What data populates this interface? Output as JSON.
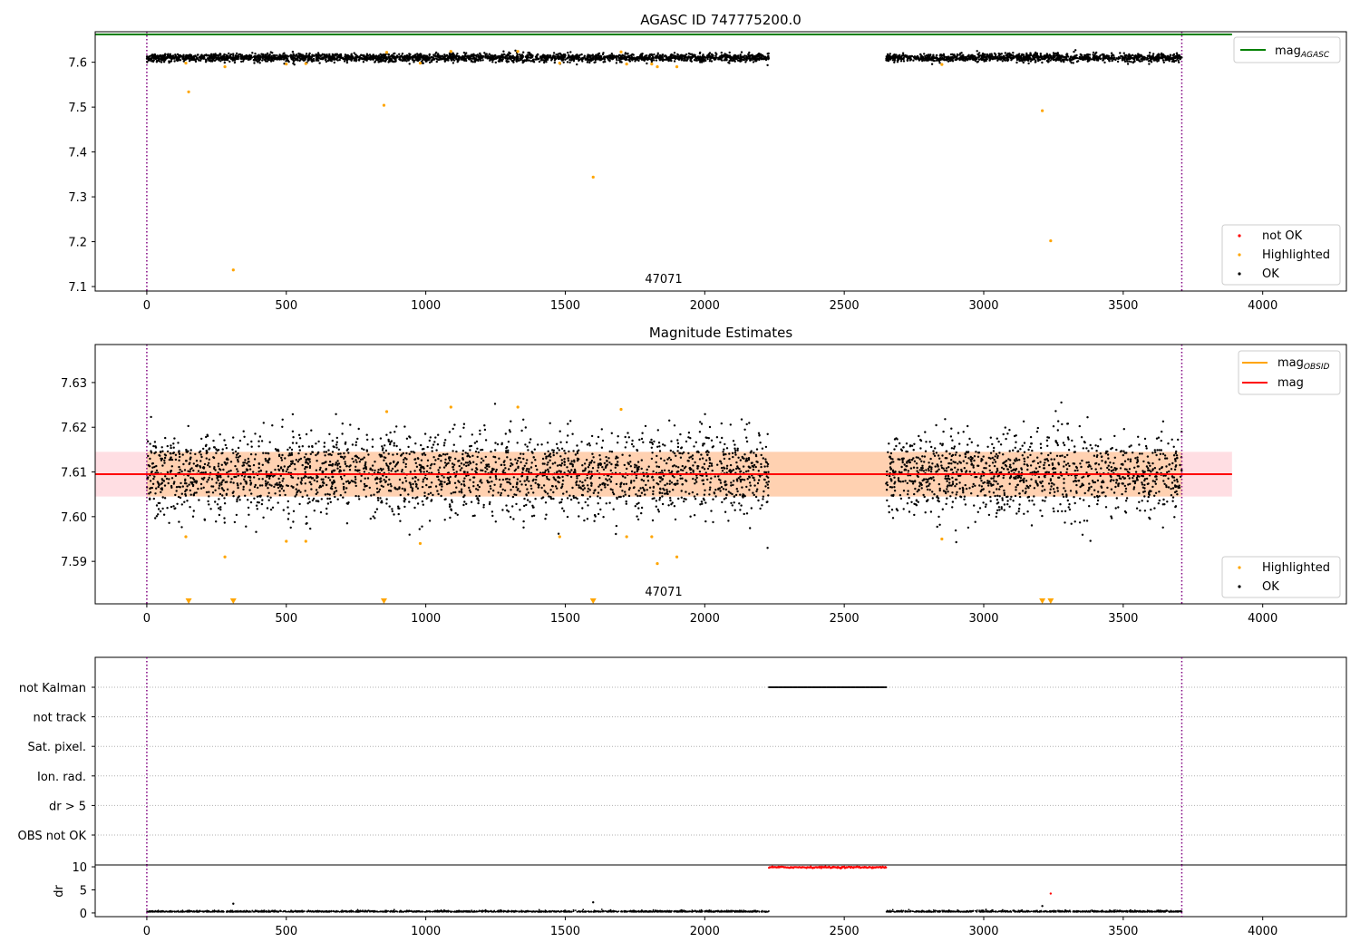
{
  "chart_data": [
    {
      "type": "scatter",
      "title": "AGASC ID 747775200.0",
      "xlim": [
        -185,
        4300
      ],
      "ylim": [
        7.09,
        7.668
      ],
      "xticks": [
        0,
        500,
        1000,
        1500,
        2000,
        2500,
        3000,
        3500,
        4000
      ],
      "yticks": [
        7.1,
        7.2,
        7.3,
        7.4,
        7.5,
        7.6
      ],
      "ytick_labels": [
        "7.1",
        "7.2",
        "7.3",
        "7.4",
        "7.5",
        "7.6"
      ],
      "obsid_label": "47071",
      "obsid_label_x": 1850,
      "vlines": [
        0,
        3710
      ],
      "vline_color": "#800080",
      "mag_agasc": 7.662,
      "mag_agasc_color": "#008000",
      "ok_segments": [
        {
          "x_start": 0,
          "x_end": 2230,
          "mean": 7.61,
          "spread": 0.006
        },
        {
          "x_start": 2650,
          "x_end": 3710,
          "mean": 7.61,
          "spread": 0.006
        }
      ],
      "highlighted_points": [
        [
          150,
          7.534
        ],
        [
          140,
          7.598
        ],
        [
          280,
          7.59
        ],
        [
          310,
          7.137
        ],
        [
          500,
          7.596
        ],
        [
          570,
          7.597
        ],
        [
          850,
          7.504
        ],
        [
          860,
          7.622
        ],
        [
          980,
          7.598
        ],
        [
          1090,
          7.624
        ],
        [
          1330,
          7.624
        ],
        [
          1480,
          7.598
        ],
        [
          1600,
          7.344
        ],
        [
          1700,
          7.623
        ],
        [
          1720,
          7.596
        ],
        [
          1810,
          7.596
        ],
        [
          1830,
          7.59
        ],
        [
          1900,
          7.59
        ],
        [
          2850,
          7.595
        ],
        [
          3210,
          7.492
        ],
        [
          3240,
          7.202
        ]
      ],
      "legend_top": [
        {
          "name": "mag",
          "subscript": "AGASC",
          "color": "#008000"
        }
      ],
      "legend_bottom": [
        {
          "name": "not OK",
          "color": "#ff0000"
        },
        {
          "name": "Highlighted",
          "color": "#ffa500"
        },
        {
          "name": "OK",
          "color": "#000000"
        }
      ],
      "legend_placement": [
        "upper right",
        "lower right"
      ]
    },
    {
      "type": "scatter",
      "title": "Magnitude Estimates",
      "xlim": [
        -185,
        4300
      ],
      "ylim": [
        7.5805,
        7.6385
      ],
      "xticks": [
        0,
        500,
        1000,
        1500,
        2000,
        2500,
        3000,
        3500,
        4000
      ],
      "yticks": [
        7.59,
        7.6,
        7.61,
        7.62,
        7.63
      ],
      "ytick_labels": [
        "7.59",
        "7.60",
        "7.61",
        "7.62",
        "7.63"
      ],
      "obsid_label": "47071",
      "obsid_label_x": 1850,
      "vlines": [
        0,
        3710
      ],
      "mag": 7.6095,
      "mag_color": "#ff0000",
      "mag_band": [
        7.6045,
        7.6145
      ],
      "mag_band_x": [
        -185,
        3890
      ],
      "mag_obsid": 7.6095,
      "mag_obsid_color": "#ffa500",
      "mag_obsid_band_x": [
        0,
        3710
      ],
      "ok_segments": [
        {
          "x_start": 0,
          "x_end": 2230,
          "mean": 7.6095,
          "spread": 0.0045
        },
        {
          "x_start": 2650,
          "x_end": 3710,
          "mean": 7.6095,
          "spread": 0.0045
        }
      ],
      "highlighted_points": [
        [
          140,
          7.5955
        ],
        [
          280,
          7.591
        ],
        [
          500,
          7.5945
        ],
        [
          570,
          7.5945
        ],
        [
          860,
          7.6235
        ],
        [
          980,
          7.594
        ],
        [
          1090,
          7.6245
        ],
        [
          1330,
          7.6245
        ],
        [
          1480,
          7.5955
        ],
        [
          1700,
          7.624
        ],
        [
          1720,
          7.5955
        ],
        [
          1810,
          7.5955
        ],
        [
          1830,
          7.5895
        ],
        [
          1900,
          7.591
        ],
        [
          2850,
          7.595
        ]
      ],
      "out_of_range_markers": [
        150,
        310,
        850,
        1600,
        3210,
        3240
      ],
      "legend_top": [
        {
          "name": "mag",
          "subscript": "OBSID",
          "color": "#ffa500"
        },
        {
          "name": "mag",
          "subscript": "",
          "color": "#ff0000"
        }
      ],
      "legend_bottom": [
        {
          "name": "Highlighted",
          "color": "#ffa500"
        },
        {
          "name": "OK",
          "color": "#000000"
        }
      ],
      "legend_placement": [
        "upper right",
        "lower right"
      ]
    },
    {
      "type": "scatter",
      "xlim": [
        -185,
        4300
      ],
      "categories": [
        "not Kalman",
        "not track",
        "Sat. pixel.",
        "Ion. rad.",
        "dr > 5",
        "OBS not OK"
      ],
      "not_kalman_range": [
        2230,
        2650
      ],
      "vlines": [
        0,
        3710
      ]
    },
    {
      "type": "scatter",
      "ylabel": "dr",
      "xlim": [
        -185,
        4300
      ],
      "ylim": [
        -0.8,
        10.4
      ],
      "xticks": [
        0,
        500,
        1000,
        1500,
        2000,
        2500,
        3000,
        3500,
        4000
      ],
      "yticks": [
        0,
        5,
        10
      ],
      "ytick_labels": [
        "0",
        "5",
        "10"
      ],
      "vlines": [
        0,
        3710
      ],
      "ok_segments": [
        {
          "x_start": 0,
          "x_end": 2230,
          "mean": 0.2,
          "spread": 0.15
        },
        {
          "x_start": 2650,
          "x_end": 3710,
          "mean": 0.2,
          "spread": 0.15
        }
      ],
      "not_ok_range": [
        2230,
        2650
      ],
      "not_ok_value": 9.9,
      "extra_ok_points": [
        [
          310,
          2.0
        ],
        [
          1600,
          2.3
        ],
        [
          3210,
          1.5
        ]
      ],
      "extra_not_ok_points": [
        [
          3240,
          4.2
        ]
      ]
    }
  ]
}
